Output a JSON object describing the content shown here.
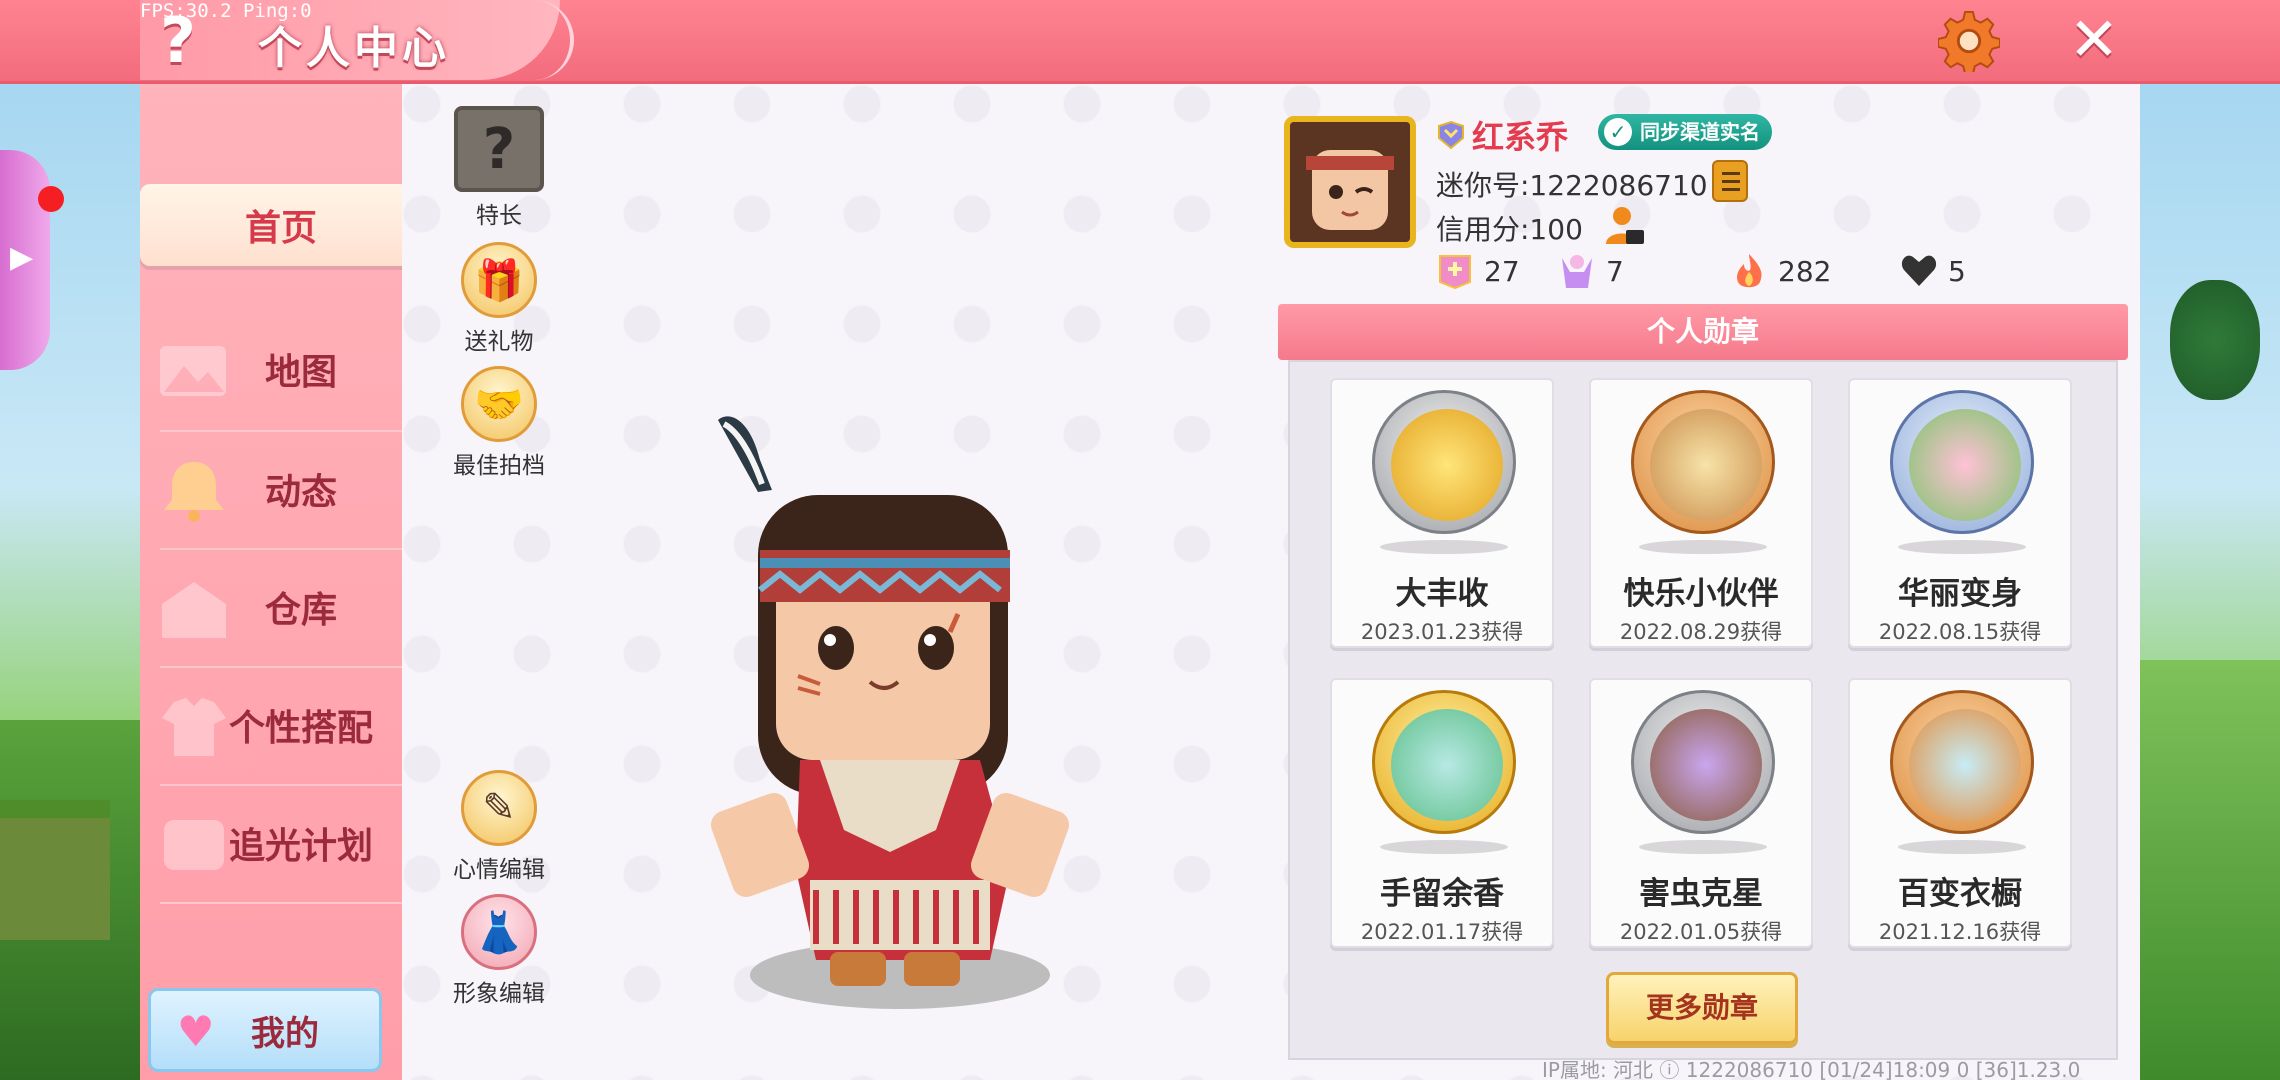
{
  "debug": {
    "fps_text": "FPS:30.2  Ping:0"
  },
  "header": {
    "title": "个人中心",
    "help_icon": "question-mark-icon",
    "settings_icon": "gear-icon",
    "close_icon": "close-icon",
    "close_glyph": "✕"
  },
  "sidebar": {
    "items": [
      {
        "label": "首页",
        "icon": "home-icon",
        "active": true
      },
      {
        "label": "地图",
        "icon": "map-icon"
      },
      {
        "label": "动态",
        "icon": "bell-icon"
      },
      {
        "label": "仓库",
        "icon": "warehouse-icon"
      },
      {
        "label": "个性搭配",
        "icon": "outfit-icon"
      },
      {
        "label": "追光计划",
        "icon": "plan-icon"
      }
    ],
    "me_button": {
      "label": "我的",
      "icon": "heart-icon"
    }
  },
  "actions": {
    "talent": {
      "label": "特长",
      "glyph": "?"
    },
    "send_gift": {
      "label": "送礼物",
      "glyph": "🎁"
    },
    "best_partner": {
      "label": "最佳拍档",
      "glyph": "🤝"
    },
    "mood_edit": {
      "label": "心情编辑",
      "glyph": "✎"
    },
    "avatar_edit": {
      "label": "形象编辑",
      "glyph": "👗"
    }
  },
  "profile": {
    "nickname": "红系乔",
    "sync_badge": "同步渠道实名",
    "uid_text": "迷你号:1222086710",
    "credit_text": "信用分:100",
    "stats": [
      {
        "icon": "level-badge-icon",
        "value": "27",
        "color": "#f08cc8"
      },
      {
        "icon": "cheer-icon",
        "value": "7",
        "color": "#c58ef0"
      },
      {
        "icon": "flame-icon",
        "value": "282",
        "color": "#ff6f4a"
      },
      {
        "icon": "heart-icon",
        "value": "5",
        "color": "#333333"
      }
    ]
  },
  "medals": {
    "header": "个人勋章",
    "items": [
      {
        "name": "大丰收",
        "date": "2023.01.23获得",
        "tier": "silver"
      },
      {
        "name": "快乐小伙伴",
        "date": "2022.08.29获得",
        "tier": "bronze"
      },
      {
        "name": "华丽变身",
        "date": "2022.08.15获得",
        "tier": "blue"
      },
      {
        "name": "手留余香",
        "date": "2022.01.17获得",
        "tier": "gold"
      },
      {
        "name": "害虫克星",
        "date": "2022.01.05获得",
        "tier": "silver"
      },
      {
        "name": "百变衣橱",
        "date": "2021.12.16获得",
        "tier": "bronze"
      }
    ],
    "more_button": "更多勋章"
  },
  "footer": {
    "text": "IP属地: 河北 ⓘ      1222086710    [01/24]18:09 0    [36]1.23.0"
  },
  "colors": {
    "accent": "#f26c7d",
    "sidebar": "#ffa3ae",
    "nickname": "#e53b4e"
  }
}
